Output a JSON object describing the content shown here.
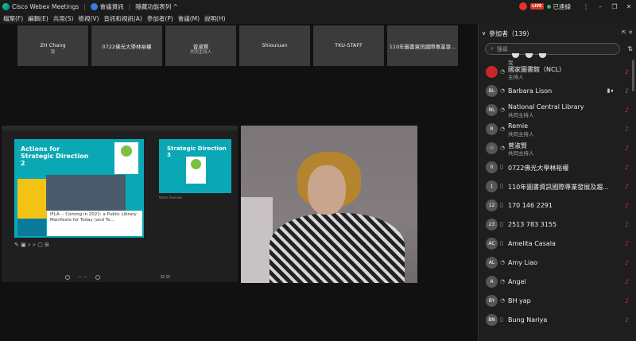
{
  "titlebar": {
    "app_name": "Cisco Webex Meetings",
    "meeting_info": "會議資訊",
    "hide_menu": "隱藏功能表列 ^",
    "live": "LIVE",
    "status": "已連線",
    "win_more": "⋮",
    "win_min": "–",
    "win_max": "❐",
    "win_close": "✕"
  },
  "menubar": [
    "檔案(F)",
    "編輯(E)",
    "共用(S)",
    "檢視(V)",
    "音訊和視訊(A)",
    "參加者(P)",
    "會議(M)",
    "說明(H)"
  ],
  "tiles": [
    {
      "name": "ZH Chang",
      "role": "我"
    },
    {
      "name": "0722佛光大學林裕權",
      "role": ""
    },
    {
      "name": "曾淑賢",
      "role": "共同主持人"
    },
    {
      "name": "Shiouiuan",
      "role": ""
    },
    {
      "name": "TKU-STAFF",
      "role": ""
    },
    {
      "name": "110年圖書資訊國際專業發...",
      "role": ""
    }
  ],
  "slide1": {
    "title": "Actions for Strategic Direction 2",
    "caption": "IFLA -- Coming in 2021: a Public Library Manifesto for Today (and To..."
  },
  "slide2": {
    "title": "Strategic Direction 3"
  },
  "notes_label": "Notes Reviews",
  "panel": {
    "title": "參加者（139）",
    "search_placeholder": "搜尋",
    "partial_role": "我",
    "participants": [
      {
        "avatar": "",
        "name": "國家圖書館（NCL）",
        "role": "主持人",
        "device": "",
        "cam": ""
      },
      {
        "avatar": "BL",
        "name": "Barbara Lison",
        "role": "",
        "device": "",
        "cam": "▮◂"
      },
      {
        "avatar": "NL",
        "name": "National Central Library",
        "role": "共同主持人",
        "device": "",
        "cam": ""
      },
      {
        "avatar": "R",
        "name": "Remie",
        "role": "共同主持人",
        "device": "",
        "cam": ""
      },
      {
        "avatar": "",
        "name": "曾淑賢",
        "role": "共同主持人",
        "device": "",
        "cam": ""
      },
      {
        "avatar": "0",
        "name": "0722佛光大學林裕權",
        "role": "",
        "device": "▯",
        "cam": ""
      },
      {
        "avatar": "1",
        "name": "110年圖書資訊國際專業發展及趨...",
        "role": "",
        "device": "▯",
        "cam": ""
      },
      {
        "avatar": "12",
        "name": "170 146 2291",
        "role": "",
        "device": "▯",
        "cam": ""
      },
      {
        "avatar": "23",
        "name": "2513 783 3155",
        "role": "",
        "device": "▯",
        "cam": ""
      },
      {
        "avatar": "AC",
        "name": "Amelita Casala",
        "role": "",
        "device": "▯",
        "cam": ""
      },
      {
        "avatar": "AL",
        "name": "Amy Liao",
        "role": "",
        "device": "",
        "cam": ""
      },
      {
        "avatar": "A",
        "name": "Angel",
        "role": "",
        "device": "",
        "cam": ""
      },
      {
        "avatar": "BY",
        "name": "BH yap",
        "role": "",
        "device": "",
        "cam": ""
      },
      {
        "avatar": "BN",
        "name": "Bung Nariya",
        "role": "",
        "device": "▯",
        "cam": ""
      }
    ]
  }
}
